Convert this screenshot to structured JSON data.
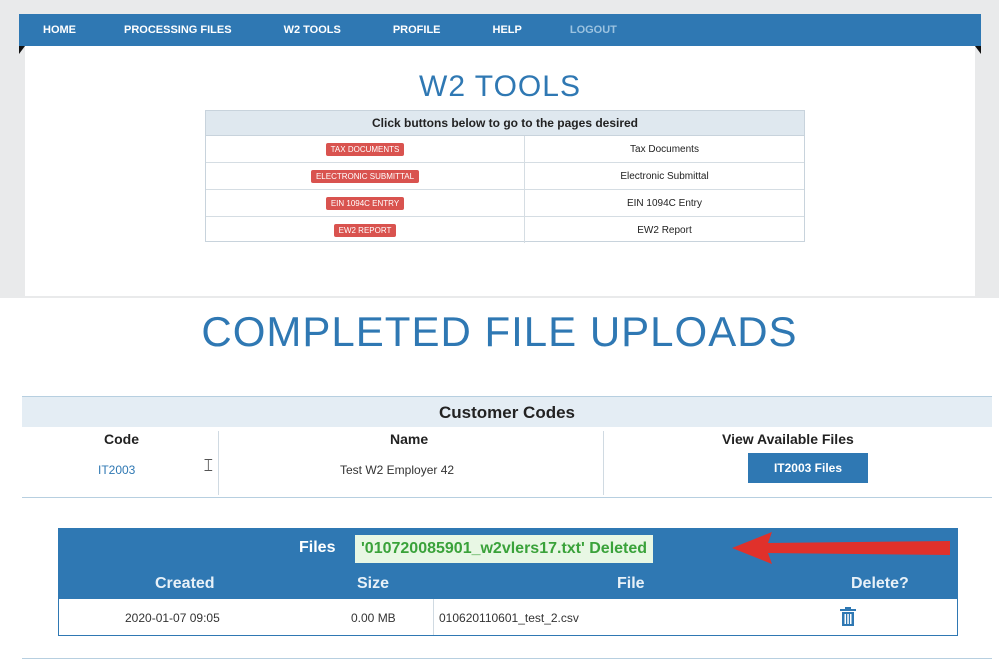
{
  "nav": {
    "items": [
      "HOME",
      "PROCESSING FILES",
      "W2 TOOLS",
      "PROFILE",
      "HELP",
      "LOGOUT"
    ]
  },
  "w2_tools": {
    "title": "W2 TOOLS",
    "table_header": "Click buttons below to go to the pages desired",
    "rows": [
      {
        "button": "TAX DOCUMENTS",
        "label": "Tax Documents"
      },
      {
        "button": "ELECTRONIC SUBMITTAL",
        "label": "Electronic Submittal"
      },
      {
        "button": "EIN 1094C ENTRY",
        "label": "EIN 1094C Entry"
      },
      {
        "button": "EW2 REPORT",
        "label": "EW2 Report"
      }
    ]
  },
  "completed": {
    "title": "COMPLETED FILE UPLOADS",
    "codes_header": "Customer Codes",
    "columns": {
      "code": "Code",
      "name": "Name",
      "view": "View Available Files"
    },
    "row": {
      "code": "IT2003",
      "name": "Test W2 Employer 42",
      "files_button": "IT2003 Files"
    }
  },
  "files": {
    "label": "Files",
    "message": "'010720085901_w2vlers17.txt' Deleted",
    "columns": {
      "created": "Created",
      "size": "Size",
      "file": "File",
      "delete": "Delete?"
    },
    "rows": [
      {
        "created": "2020-01-07 09:05",
        "size": "0.00 MB",
        "file": "010620110601_test_2.csv"
      }
    ]
  },
  "icons": {
    "trash": "trash-icon",
    "arrow": "red-arrow-icon",
    "cursor": "text-cursor-icon"
  },
  "colors": {
    "nav": "#2f78b3",
    "button_red": "#d9534f",
    "success_green": "#3aa23a",
    "arrow_red": "#e0312b"
  }
}
